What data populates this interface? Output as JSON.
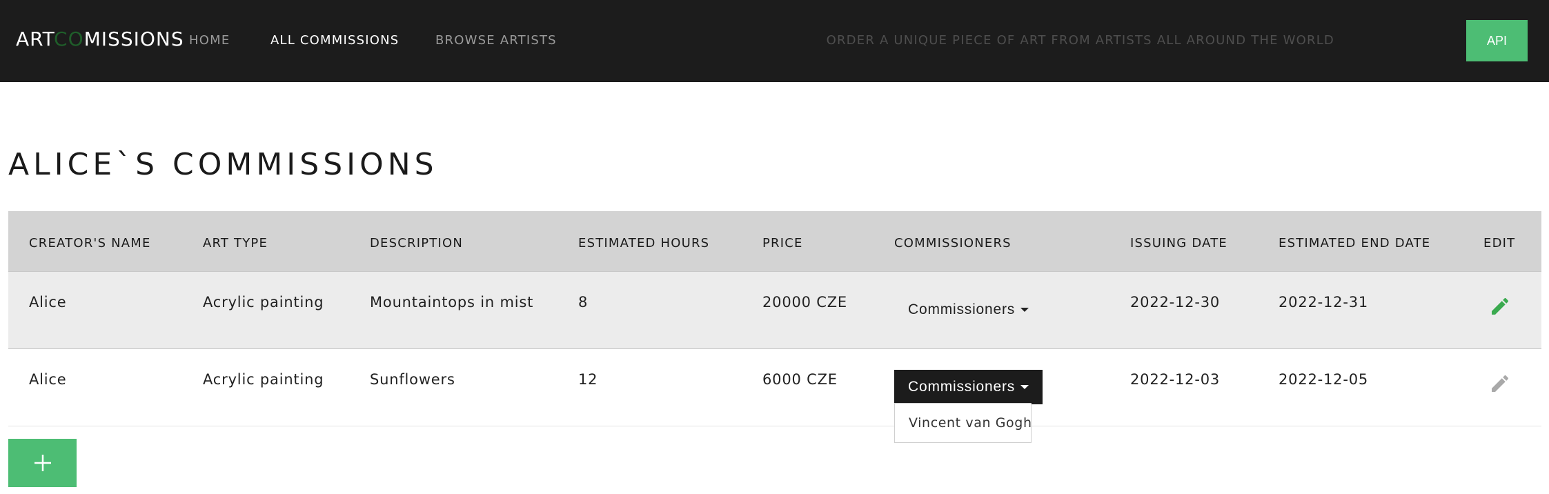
{
  "brand": {
    "part1": "ART",
    "part2": "CO",
    "part3": "MISSIONS"
  },
  "nav": {
    "home": "HOME",
    "all_commissions": "ALL COMMISSIONS",
    "browse_artists": "BROWSE ARTISTS"
  },
  "tagline": "ORDER A UNIQUE PIECE OF ART FROM ARTISTS ALL AROUND THE WORLD",
  "api_label": "API",
  "page_title": "ALICE`S COMMISSIONS",
  "table": {
    "headers": [
      "CREATOR'S NAME",
      "ART TYPE",
      "DESCRIPTION",
      "ESTIMATED HOURS",
      "PRICE",
      "COMMISSIONERS",
      "ISSUING DATE",
      "ESTIMATED END DATE",
      "EDIT"
    ],
    "rows": [
      {
        "creator": "Alice",
        "art_type": "Acrylic painting",
        "description": "Mountaintops in mist",
        "hours": "8",
        "price": "20000 CZE",
        "commissioners_label": "Commissioners",
        "issuing_date": "2022-12-30",
        "end_date": "2022-12-31"
      },
      {
        "creator": "Alice",
        "art_type": "Acrylic painting",
        "description": "Sunflowers",
        "hours": "12",
        "price": "6000 CZE",
        "commissioners_label": "Commissioners",
        "issuing_date": "2022-12-03",
        "end_date": "2022-12-05"
      }
    ]
  },
  "dropdown": {
    "items": [
      "Vincent van Gogh"
    ]
  },
  "add_button_icon": "plus-icon",
  "colors": {
    "accent": "#4dbd74",
    "navbar": "#1c1c1c",
    "header_row": "#d3d3d3",
    "edit_active": "#3aaa4f",
    "edit_inactive": "#a9a9a9"
  }
}
